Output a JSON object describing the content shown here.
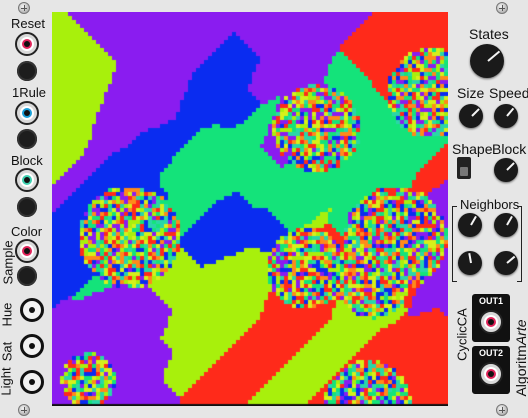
{
  "module": {
    "name": "CyclicCA",
    "brand_prefix": "Algoritm",
    "brand_suffix": "Arte"
  },
  "inputs": {
    "reset": "Reset",
    "one_rule": "1Rule",
    "block": "Block",
    "color": "Color",
    "sample": "Sample",
    "hue": "Hue",
    "sat": "Sat",
    "light": "Light"
  },
  "controls": {
    "states": "States",
    "size": "Size",
    "speed": "Speed",
    "shape": "Shape",
    "block": "Block",
    "neighbors": "Neighbors"
  },
  "outputs": {
    "out1": "OUT1",
    "out2": "OUT2"
  },
  "colors": {
    "panel": "#e6e6e6",
    "palette": [
      "#ff2a1a",
      "#a8f00c",
      "#14e37a",
      "#8a1cf0",
      "#0a2cf0",
      "#ff8a1a",
      "#d6f01a",
      "#2ad6a8"
    ]
  }
}
